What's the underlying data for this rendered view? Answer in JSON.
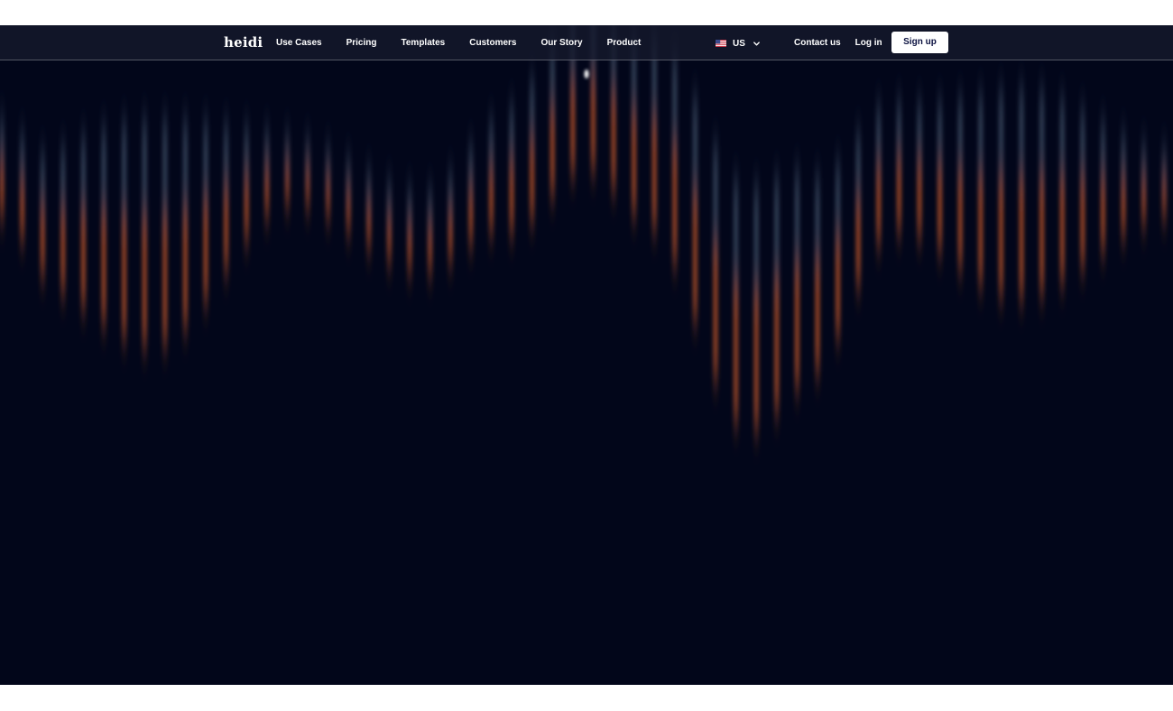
{
  "header": {
    "logo": "heidi",
    "nav": [
      {
        "label": "Use Cases"
      },
      {
        "label": "Pricing"
      },
      {
        "label": "Templates"
      },
      {
        "label": "Customers"
      },
      {
        "label": "Our Story"
      },
      {
        "label": "Product"
      }
    ],
    "region": {
      "flag": "us-flag-icon",
      "label": "US",
      "chevron": "chevron-down-icon"
    },
    "contact_label": "Contact us",
    "login_label": "Log in",
    "signup_label": "Sign up"
  },
  "colors": {
    "page_background": "#02061a",
    "navbar_background": "#16192d",
    "accent_orange": "#c8582a",
    "accent_steel": "#5a6e86",
    "button_text": "#0b1140"
  }
}
